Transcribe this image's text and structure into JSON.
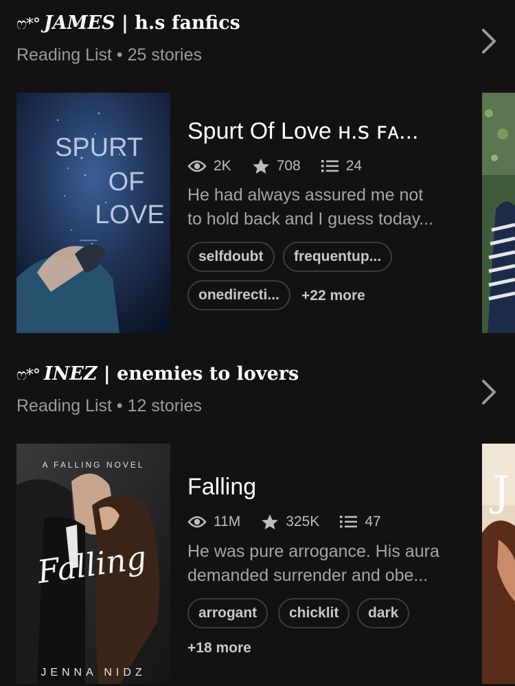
{
  "lists": [
    {
      "decoration": "ෆ*°",
      "title_name": "JAMES",
      "title_rest": " | h.s fanfics",
      "subtitle": "Reading List • 25 stories",
      "story": {
        "cover_title": [
          "SPURT",
          "OF",
          "LOVE"
        ],
        "title": "Spurt Of Love ʜ.ꜱ ꜰᴀ...",
        "reads": "2K",
        "votes": "708",
        "parts": "24",
        "description": [
          "He had always assured me not",
          "to hold back and I guess today..."
        ],
        "tags": [
          "selfdoubt",
          "frequentup...",
          "onedirecti..."
        ],
        "more": "+22 more"
      }
    },
    {
      "decoration": "ෆ*°",
      "title_name": "INEZ",
      "title_rest": " | enemies to lovers",
      "subtitle": "Reading List • 12 stories",
      "story": {
        "cover_top": "A FALLING NOVEL",
        "cover_script": "Falling",
        "cover_author": "JENNA NIDZ",
        "title": "Falling",
        "reads": "11M",
        "votes": "325K",
        "parts": "47",
        "description": [
          "He was pure arrogance. His aura",
          "demanded surrender and obe..."
        ],
        "tags": [
          "arrogant",
          "chicklit",
          "dark"
        ],
        "more": "+18 more"
      }
    }
  ]
}
